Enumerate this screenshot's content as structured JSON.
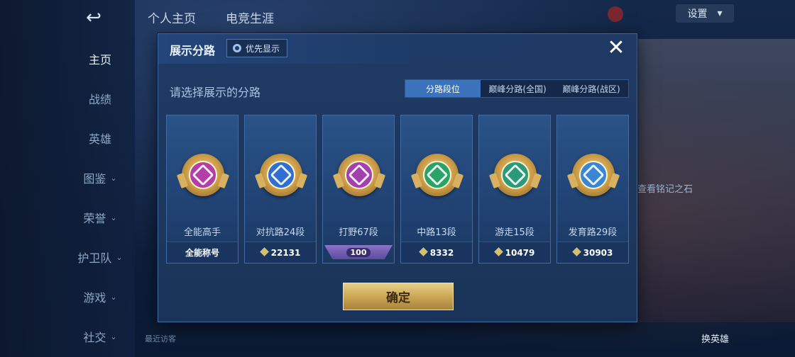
{
  "background": {
    "top_tabs": [
      "个人主页",
      "电竞生涯"
    ],
    "settings_label": "设置",
    "right_hint": "查看铭记之石",
    "swap_hero_label": "换英雄",
    "recent_label": "最近访客"
  },
  "nav": {
    "back_symbol": "↩",
    "items": [
      {
        "label": "主页",
        "chevron": ""
      },
      {
        "label": "战绩",
        "chevron": ""
      },
      {
        "label": "英雄",
        "chevron": ""
      },
      {
        "label": "图鉴",
        "chevron": "⌄"
      },
      {
        "label": "荣誉",
        "chevron": "⌄"
      },
      {
        "label": "护卫队",
        "chevron": "⌄"
      },
      {
        "label": "游戏",
        "chevron": "⌄"
      },
      {
        "label": "社交",
        "chevron": "⌄"
      }
    ]
  },
  "modal": {
    "title": "展示分路",
    "priority_label": "优先显示",
    "close_symbol": "✕",
    "subtitle": "请选择展示的分路",
    "tabs": [
      {
        "label": "分路段位",
        "active": true
      },
      {
        "label": "巅峰分路(全国)",
        "active": false
      },
      {
        "label": "巅峰分路(战区)",
        "active": false
      }
    ],
    "cards": [
      {
        "label": "全能高手",
        "footer": "全能称号",
        "footer_type": "text",
        "color": "#b43ea8"
      },
      {
        "label": "对抗路24段",
        "footer": "22131",
        "footer_type": "points",
        "color": "#2f6fd0"
      },
      {
        "label": "打野67段",
        "footer": "100",
        "footer_type": "badge",
        "color": "#a43fb0"
      },
      {
        "label": "中路13段",
        "footer": "8332",
        "footer_type": "points",
        "color": "#2aa36a"
      },
      {
        "label": "游走15段",
        "footer": "10479",
        "footer_type": "points",
        "color": "#2a9a7a"
      },
      {
        "label": "发育路29段",
        "footer": "30903",
        "footer_type": "points",
        "color": "#3a86d6"
      }
    ],
    "confirm_label": "确定"
  }
}
